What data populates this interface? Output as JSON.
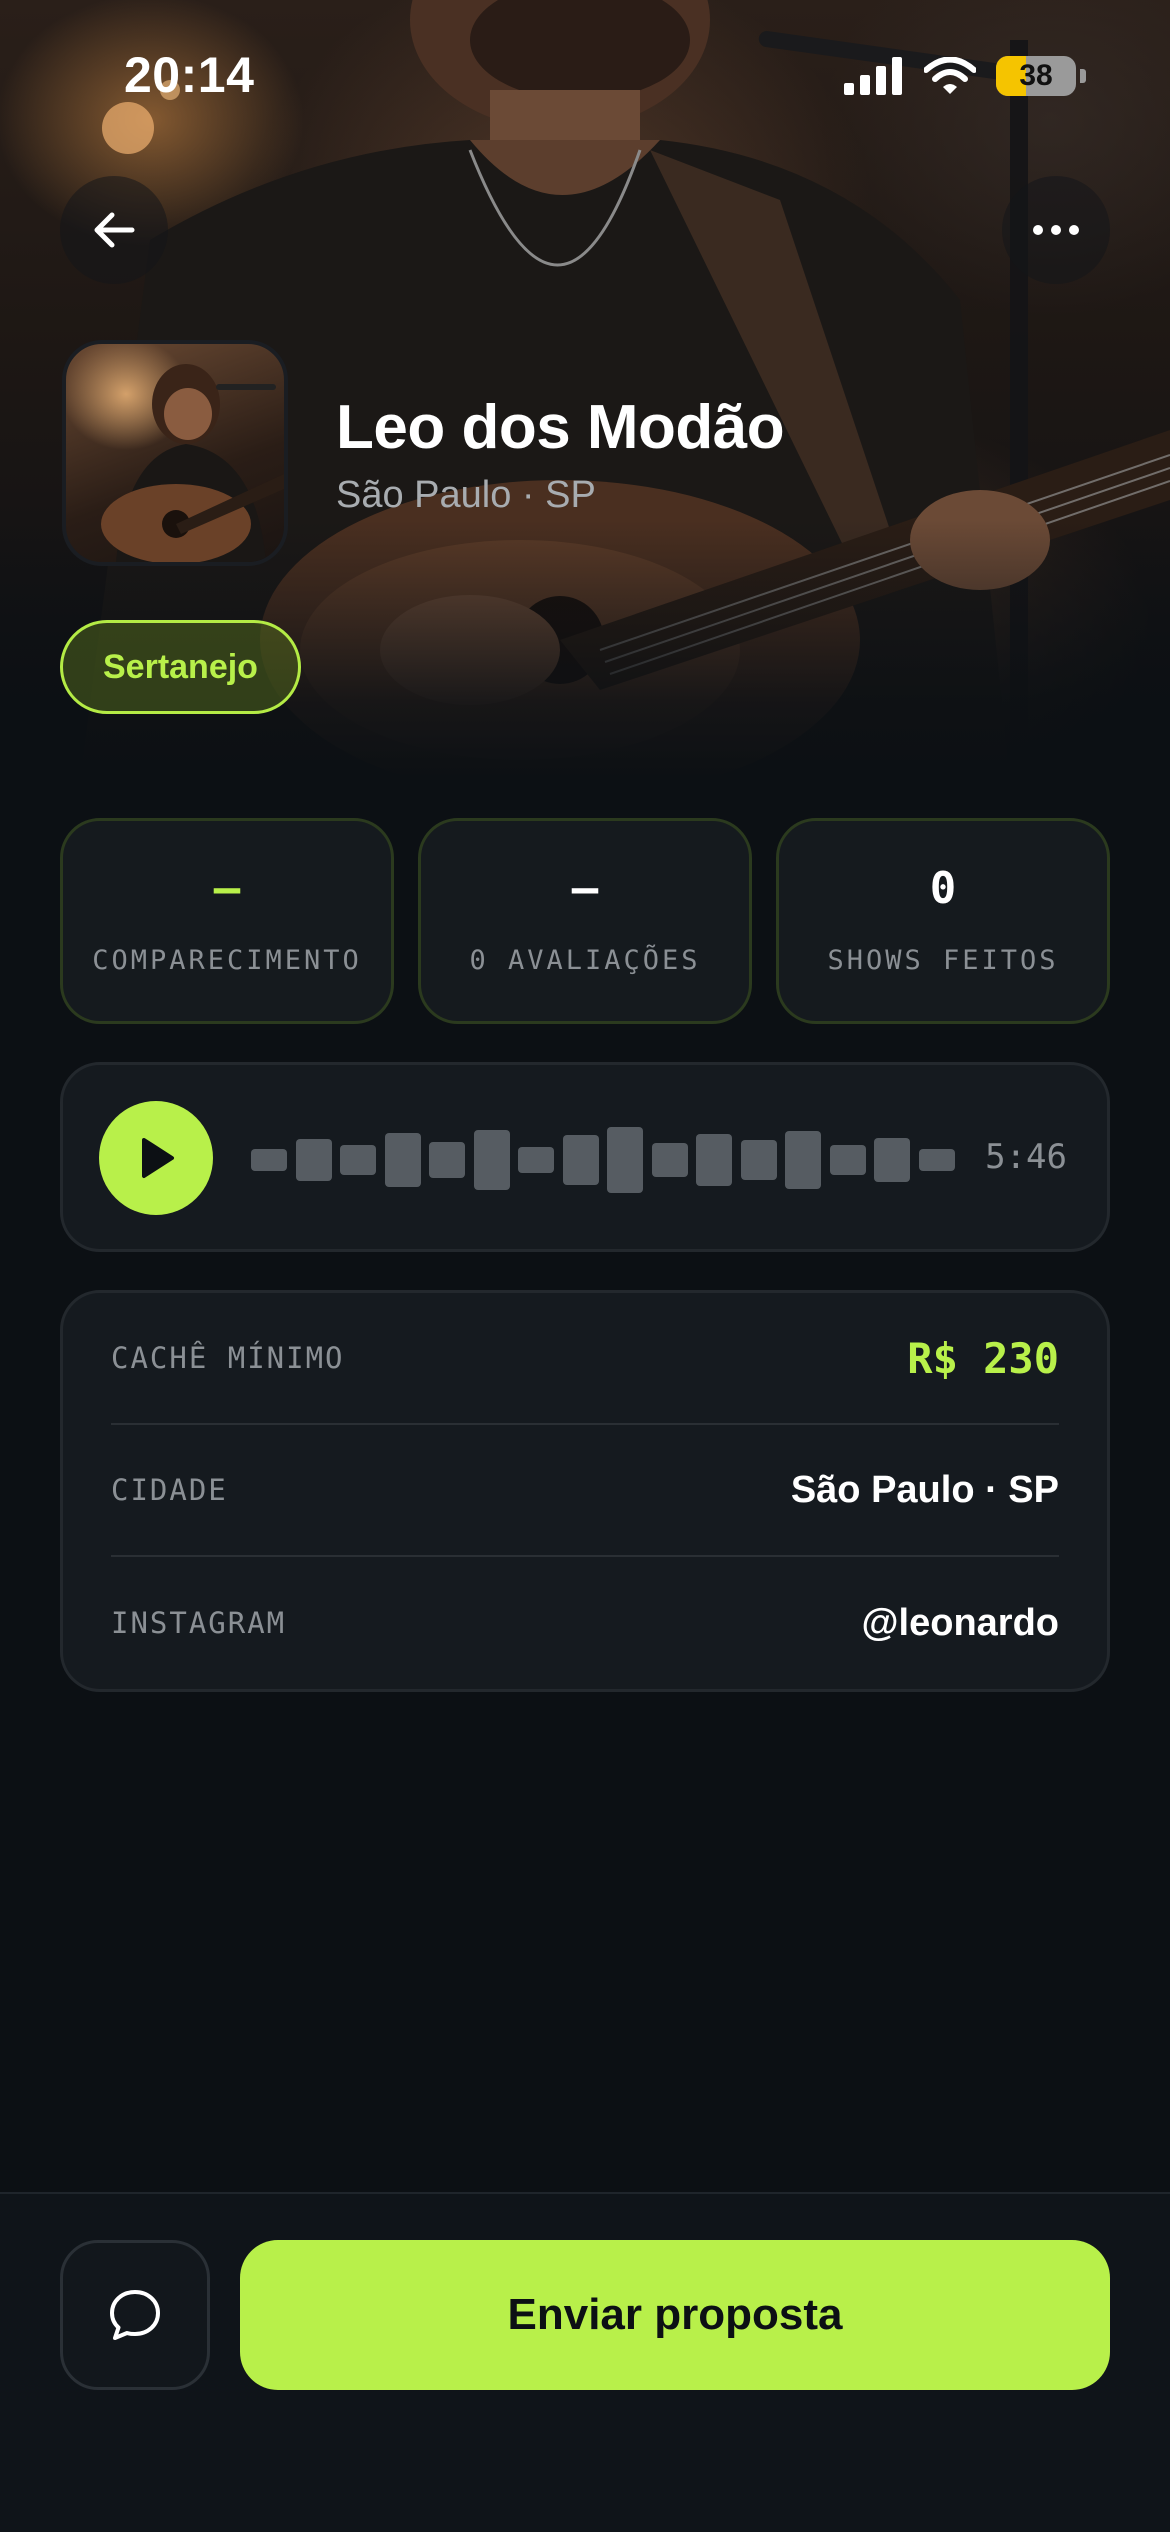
{
  "status_bar": {
    "time": "20:14",
    "battery": "38",
    "battery_level": 0.38
  },
  "header": {
    "back_icon": "arrow-left-icon",
    "more_icon": "more-horizontal-icon"
  },
  "profile": {
    "name": "Leo dos Modão",
    "city": "São Paulo · SP",
    "genre": "Sertanejo"
  },
  "stats": [
    {
      "value": "–",
      "label": "COMPARECIMENTO"
    },
    {
      "value": "–",
      "label": "0 AVALIAÇÕES"
    },
    {
      "value": "0",
      "label": "SHOWS FEITOS"
    }
  ],
  "player": {
    "duration": "5:46",
    "play_icon": "play-icon"
  },
  "info": [
    {
      "label": "CACHÊ MÍNIMO",
      "value": "R$ 230"
    },
    {
      "label": "CIDADE",
      "value": "São Paulo · SP"
    },
    {
      "label": "INSTAGRAM",
      "value": "@leonardo"
    }
  ],
  "actions": {
    "chat_icon": "chat-bubble-icon",
    "cta_label": "Enviar proposta"
  },
  "colors": {
    "accent": "#b8f04a",
    "background": "#0c1014",
    "card": "#151a1f"
  }
}
